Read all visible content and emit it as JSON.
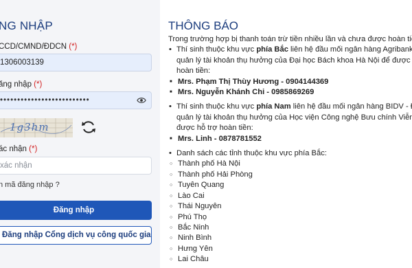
{
  "login": {
    "title": "ĐĂNG NHẬP",
    "title_visible": "NG NHẬP",
    "id_label": "CCD/CMND/ĐDCN",
    "id_value": "1306003139",
    "password_label": "ăng nhập",
    "required_mark": "(*)",
    "captcha_text": "1g3hm",
    "confirm_label": "ác nhận",
    "confirm_placeholder": "xác nhận",
    "forgot_text": "n mã đăng nhập ?",
    "login_button": "Đăng nhập",
    "gov_login_button": "Đăng nhập Cổng dịch vụ công quốc gia"
  },
  "notice": {
    "title": "THÔNG BÁO",
    "intro": "Trong trường hợp bị thanh toán trừ tiền nhiều lần và chưa được hoàn tiền",
    "north_line1_a": "Thí sinh thuộc khu vực ",
    "north_bold": "phía Bắc",
    "north_line1_b": " liên hệ đầu mối ngân hàng Agribank - Đơn",
    "north_line2": "quản lý tài khoản thụ hưởng của Đại học Bách khoa Hà Nội để được hỗ trợ",
    "north_line3": "hoàn tiền:",
    "north_contacts": [
      "Mrs. Phạm Thị Thùy Hương - 0904144369",
      "Mrs. Nguyễn Khánh Chi - 0985869269"
    ],
    "south_line1_a": "Thí sinh thuộc khu vực ",
    "south_bold": "phía Nam",
    "south_line1_b": " liên hệ đầu mối ngân hàng BIDV - Đơn vị",
    "south_line2": "quản lý tài khoản thụ hưởng của Học viện Công nghệ Bưu chính Viễn thông",
    "south_line3": "được hỗ trợ hoàn tiền:",
    "south_contacts": [
      "Mrs. Linh - 0878781552"
    ],
    "provinces_heading": "Danh sách các tỉnh thuộc khu vực phía Bắc:",
    "provinces": [
      "Thành phố Hà Nội",
      "Thành phố Hải Phòng",
      "Tuyên Quang",
      "Lào Cai",
      "Thái Nguyên",
      "Phú Thọ",
      "Bắc Ninh",
      "Ninh Bình",
      "Hưng Yên",
      "Lai Châu"
    ]
  },
  "icons": {
    "eye": "eye-icon",
    "refresh": "refresh-icon"
  },
  "colors": {
    "primary": "#1f57b8",
    "title": "#1b3c7d",
    "required": "#d21f1f",
    "input_fill": "#e6eefc"
  }
}
